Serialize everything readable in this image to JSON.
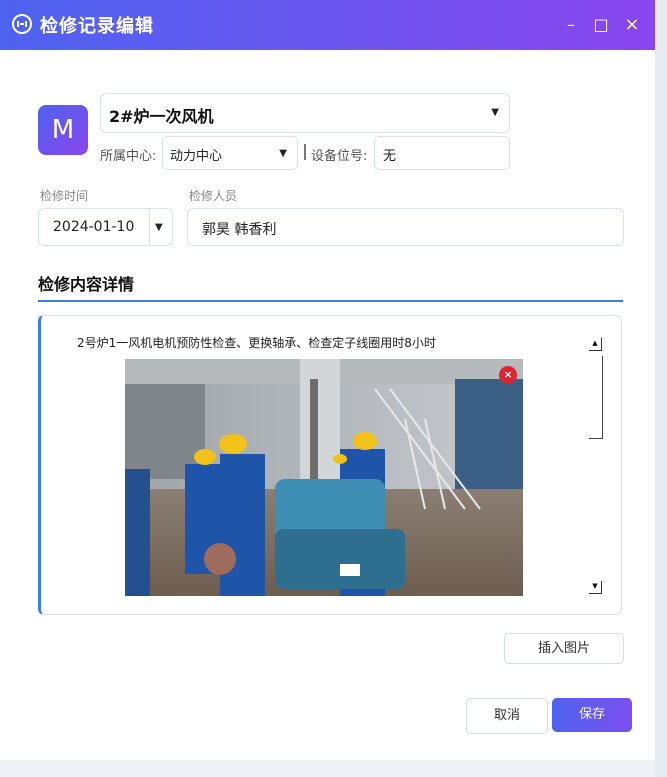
{
  "window": {
    "title": "检修记录编辑",
    "controls": {
      "minimize": "–",
      "maximize": "□",
      "close": "×"
    }
  },
  "avatar": {
    "letter": "M"
  },
  "device": {
    "selected": "2#炉一次风机"
  },
  "center": {
    "label": "所属中心:",
    "selected": "动力中心"
  },
  "position": {
    "label": "设备位号:",
    "value": "无"
  },
  "repair": {
    "date_label": "检修时间",
    "date_value": "2024-01-10",
    "people_label": "检修人员",
    "people_value": "郭昊  韩香利"
  },
  "details": {
    "section_title": "检修内容详情",
    "text": "2号炉1一风机电机预防性检查、更换轴承、检查定子线圈用时8小时",
    "photo_remove": "×"
  },
  "scroll": {
    "up": "▲",
    "down": "▼"
  },
  "actions": {
    "insert_image": "插入图片",
    "cancel": "取消",
    "save": "保存"
  },
  "icons": [
    "app-logo-icon",
    "minimize-icon",
    "maximize-icon",
    "close-icon",
    "chevron-down-icon",
    "remove-photo-icon"
  ],
  "colors": {
    "title_gradient_start": "#4e63ef",
    "title_gradient_end": "#8a45ee",
    "accent_blue": "#3b7ee8",
    "remove_red": "#e0242f"
  }
}
